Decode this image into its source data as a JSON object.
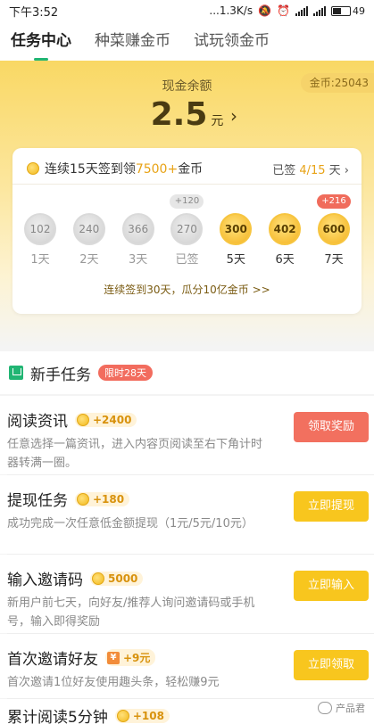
{
  "status_bar": {
    "time": "下午3:52",
    "network_speed": "...1.3K/s",
    "battery": "49"
  },
  "tabs": [
    {
      "label": "任务中心",
      "active": true
    },
    {
      "label": "种菜赚金币",
      "active": false
    },
    {
      "label": "试玩领金币",
      "active": false
    }
  ],
  "hero": {
    "coin_balance": "金币:25043",
    "cash_label": "现金余额",
    "cash_amount": "2.5",
    "cash_unit": "元",
    "cash_arrow": "›"
  },
  "checkin": {
    "title_prefix": "连续15天签到领",
    "title_highlight": "7500+",
    "title_suffix": "金币",
    "progress_prefix": "已签 ",
    "progress_value": "4/15",
    "progress_suffix": " 天 ›",
    "days": [
      {
        "bubble": "",
        "coin": "102",
        "label": "1天",
        "state": "done"
      },
      {
        "bubble": "",
        "coin": "240",
        "label": "2天",
        "state": "done"
      },
      {
        "bubble": "",
        "coin": "366",
        "label": "3天",
        "state": "done"
      },
      {
        "bubble": "+120",
        "coin": "270",
        "label": "已签",
        "state": "done"
      },
      {
        "bubble": "",
        "coin": "300",
        "label": "5天",
        "state": "todo"
      },
      {
        "bubble": "",
        "coin": "402",
        "label": "6天",
        "state": "todo"
      },
      {
        "bubble": "+216",
        "coin": "600",
        "label": "7天",
        "state": "todo"
      }
    ],
    "footer": "连续签到30天，瓜分10亿金币  >>"
  },
  "newbie": {
    "title": "新手任务",
    "badge": "限时28天"
  },
  "tasks": [
    {
      "title": "阅读资讯",
      "reward": "+2400",
      "reward_type": "coin",
      "desc": "任意选择一篇资讯，进入内容页阅读至右下角计时器转满一圈。",
      "button": "领取奖励",
      "button_style": "red"
    },
    {
      "title": "提现任务",
      "reward": "+180",
      "reward_type": "coin",
      "desc": "成功完成一次任意低金额提现（1元/5元/10元）",
      "button": "立即提现",
      "button_style": "yellow"
    },
    {
      "title": "输入邀请码",
      "reward": "5000",
      "reward_type": "coin",
      "desc": "新用户前七天，向好友/推荐人询问邀请码或手机号，输入即得奖励",
      "button": "立即输入",
      "button_style": "yellow"
    },
    {
      "title": "首次邀请好友",
      "reward": "+9元",
      "reward_type": "rmb",
      "desc": "首次邀请1位好友使用趣头条，轻松赚9元",
      "button": "立即领取",
      "button_style": "yellow"
    },
    {
      "title": "累计阅读5分钟",
      "reward": "+108",
      "reward_type": "coin",
      "desc": "",
      "button": "",
      "button_style": "yellow"
    }
  ],
  "watermark": "产品君"
}
